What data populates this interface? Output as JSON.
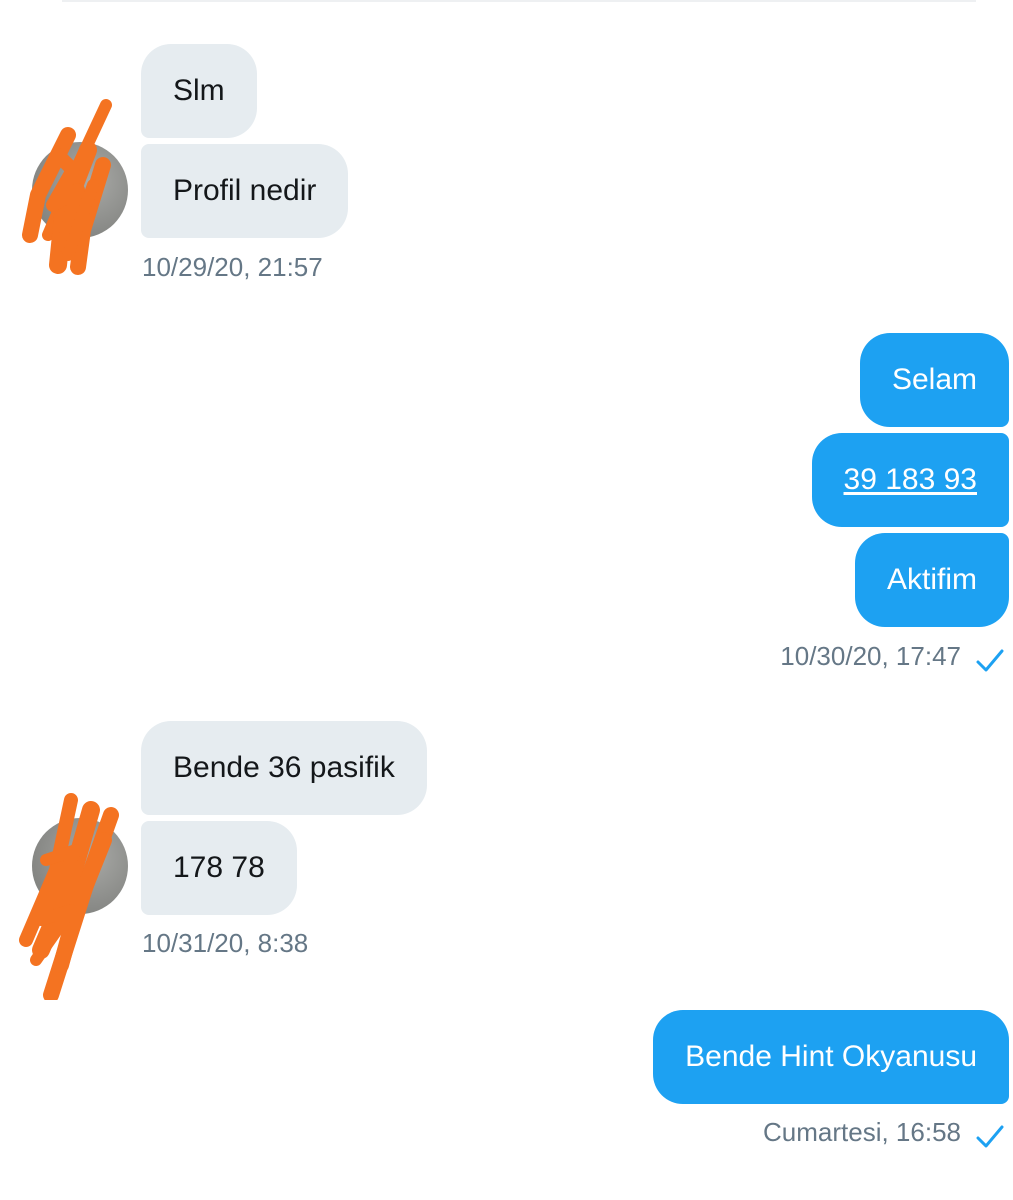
{
  "conversation": {
    "groups": [
      {
        "side": "incoming",
        "messages": [
          {
            "text": "Slm"
          },
          {
            "text": "Profil nedir"
          }
        ],
        "timestamp": "10/29/20, 21:57"
      },
      {
        "side": "outgoing",
        "messages": [
          {
            "text": "Selam"
          },
          {
            "text": "39 183 93",
            "is_link": true
          },
          {
            "text": "Aktifim"
          }
        ],
        "timestamp": "10/30/20, 17:47",
        "status_icon": "check-icon"
      },
      {
        "side": "incoming",
        "messages": [
          {
            "text": "Bende 36 pasifik"
          },
          {
            "text": "178 78"
          }
        ],
        "timestamp": "10/31/20, 8:38"
      },
      {
        "side": "outgoing",
        "messages": [
          {
            "text": "Bende Hint Okyanusu"
          }
        ],
        "timestamp": "Cumartesi, 16:58",
        "status_icon": "check-icon"
      }
    ]
  },
  "colors": {
    "outgoing_bubble": "#1da1f2",
    "incoming_bubble": "#e6ecf0",
    "timestamp_text": "#657786",
    "redaction_scribble": "#f47321",
    "check_icon": "#1da1f2"
  },
  "icons": {
    "avatar_redaction": "orange-scribble-redaction",
    "read_status": "check-icon"
  }
}
